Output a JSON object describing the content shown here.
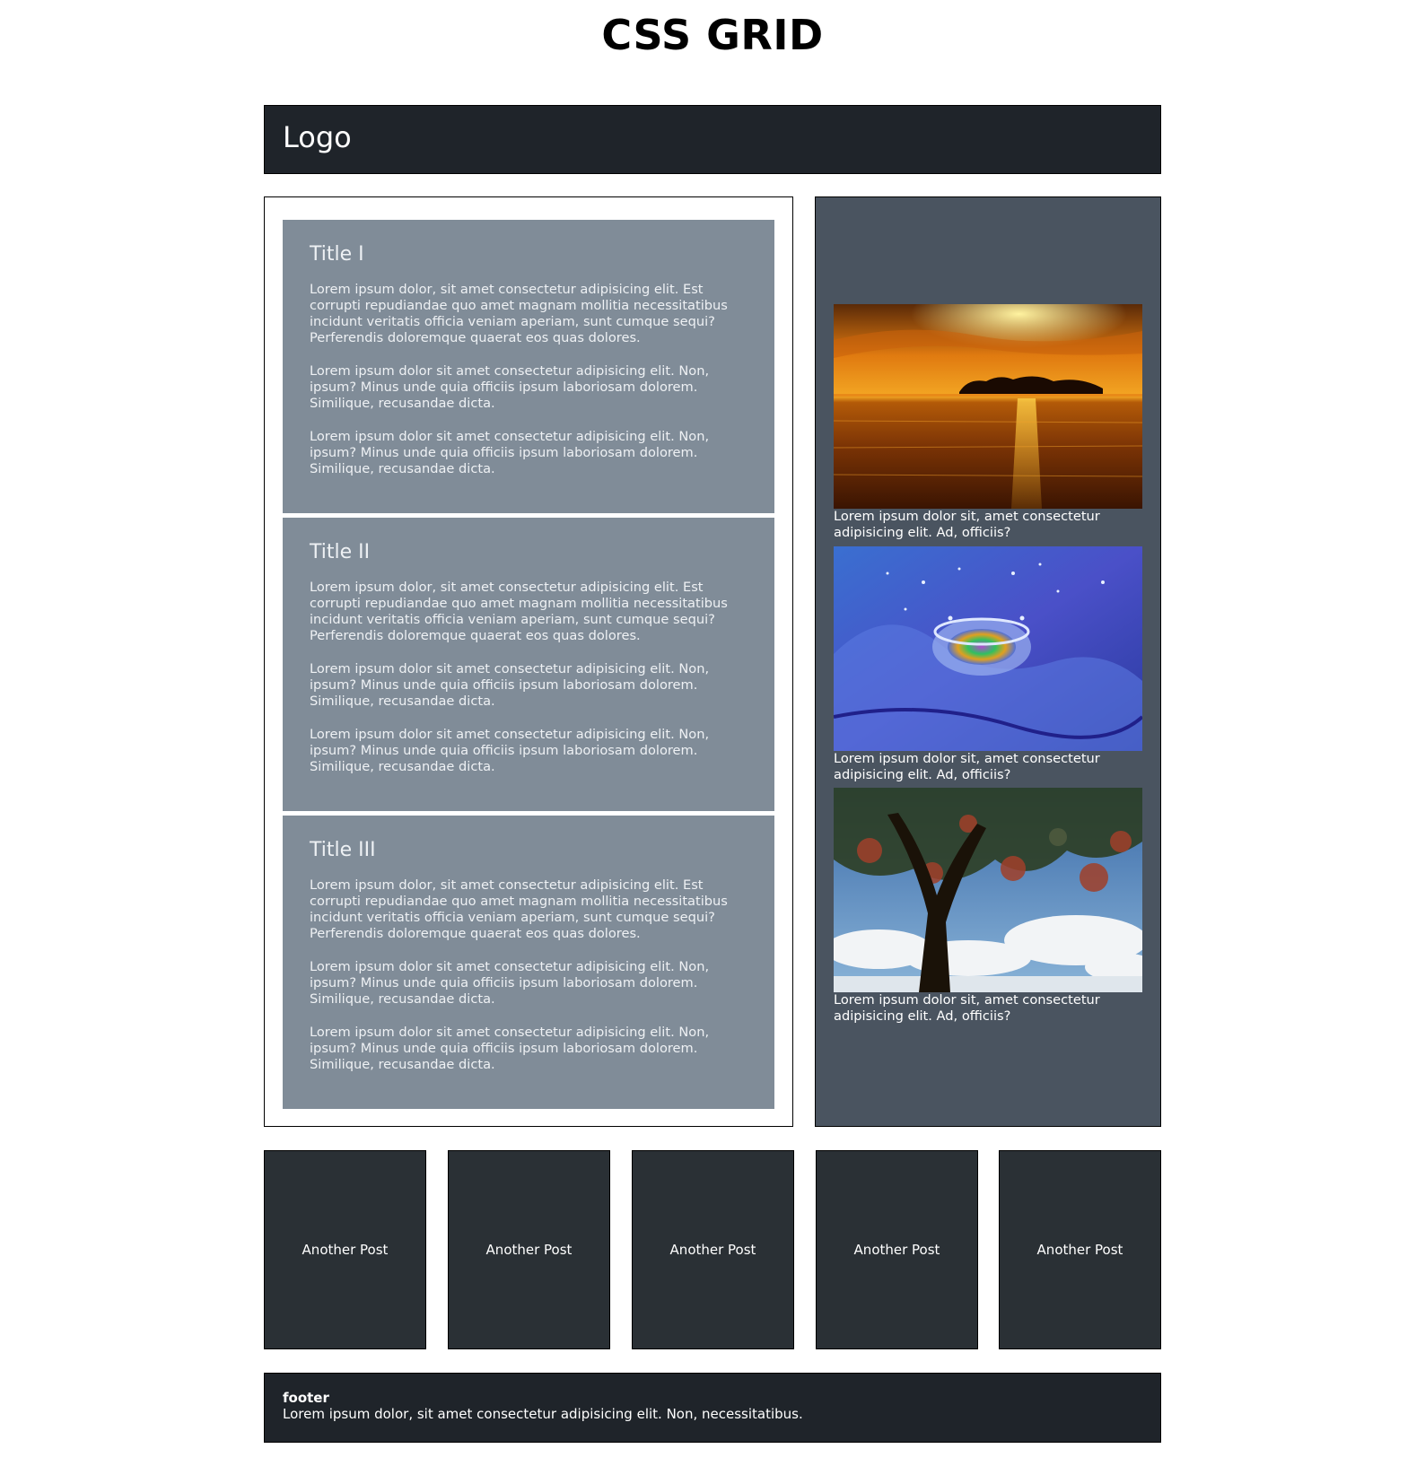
{
  "page_title": "CSS GRID",
  "header": {
    "logo": "Logo"
  },
  "articles": [
    {
      "title": "Title I",
      "paragraphs": [
        "Lorem ipsum dolor, sit amet consectetur adipisicing elit. Est corrupti repudiandae quo amet magnam mollitia necessitatibus incidunt veritatis officia veniam aperiam, sunt cumque sequi? Perferendis doloremque quaerat eos quas dolores.",
        "Lorem ipsum dolor sit amet consectetur adipisicing elit. Non, ipsum? Minus unde quia officiis ipsum laboriosam dolorem. Similique, recusandae dicta.",
        "Lorem ipsum dolor sit amet consectetur adipisicing elit. Non, ipsum? Minus unde quia officiis ipsum laboriosam dolorem. Similique, recusandae dicta."
      ]
    },
    {
      "title": "Title II",
      "paragraphs": [
        "Lorem ipsum dolor, sit amet consectetur adipisicing elit. Est corrupti repudiandae quo amet magnam mollitia necessitatibus incidunt veritatis officia veniam aperiam, sunt cumque sequi? Perferendis doloremque quaerat eos quas dolores.",
        "Lorem ipsum dolor sit amet consectetur adipisicing elit. Non, ipsum? Minus unde quia officiis ipsum laboriosam dolorem. Similique, recusandae dicta.",
        "Lorem ipsum dolor sit amet consectetur adipisicing elit. Non, ipsum? Minus unde quia officiis ipsum laboriosam dolorem. Similique, recusandae dicta."
      ]
    },
    {
      "title": "Title III",
      "paragraphs": [
        "Lorem ipsum dolor, sit amet consectetur adipisicing elit. Est corrupti repudiandae quo amet magnam mollitia necessitatibus incidunt veritatis officia veniam aperiam, sunt cumque sequi? Perferendis doloremque quaerat eos quas dolores.",
        "Lorem ipsum dolor sit amet consectetur adipisicing elit. Non, ipsum? Minus unde quia officiis ipsum laboriosam dolorem. Similique, recusandae dicta.",
        "Lorem ipsum dolor sit amet consectetur adipisicing elit. Non, ipsum? Minus unde quia officiis ipsum laboriosam dolorem. Similique, recusandae dicta."
      ]
    }
  ],
  "sidebar": {
    "figures": [
      {
        "image": "sunset-lake-island-photo",
        "caption": "Lorem ipsum dolor sit, amet consectetur adipisicing elit. Ad, officiis?"
      },
      {
        "image": "water-droplet-splash-photo",
        "caption": "Lorem ipsum dolor sit, amet consectetur adipisicing elit. Ad, officiis?"
      },
      {
        "image": "autumn-tree-sky-photo",
        "caption": "Lorem ipsum dolor sit, amet consectetur adipisicing elit. Ad, officiis?"
      }
    ]
  },
  "posts": [
    "Another Post",
    "Another Post",
    "Another Post",
    "Another Post",
    "Another Post"
  ],
  "footer": {
    "title": "footer",
    "text": "Lorem ipsum dolor, sit amet consectetur adipisicing elit. Non, necessitatibus."
  },
  "colors": {
    "header_bg": "#1f242a",
    "article_bg": "#808c98",
    "sidebar_bg": "#4a5460",
    "post_bg": "#2a3035",
    "footer_bg": "#1f242a"
  }
}
